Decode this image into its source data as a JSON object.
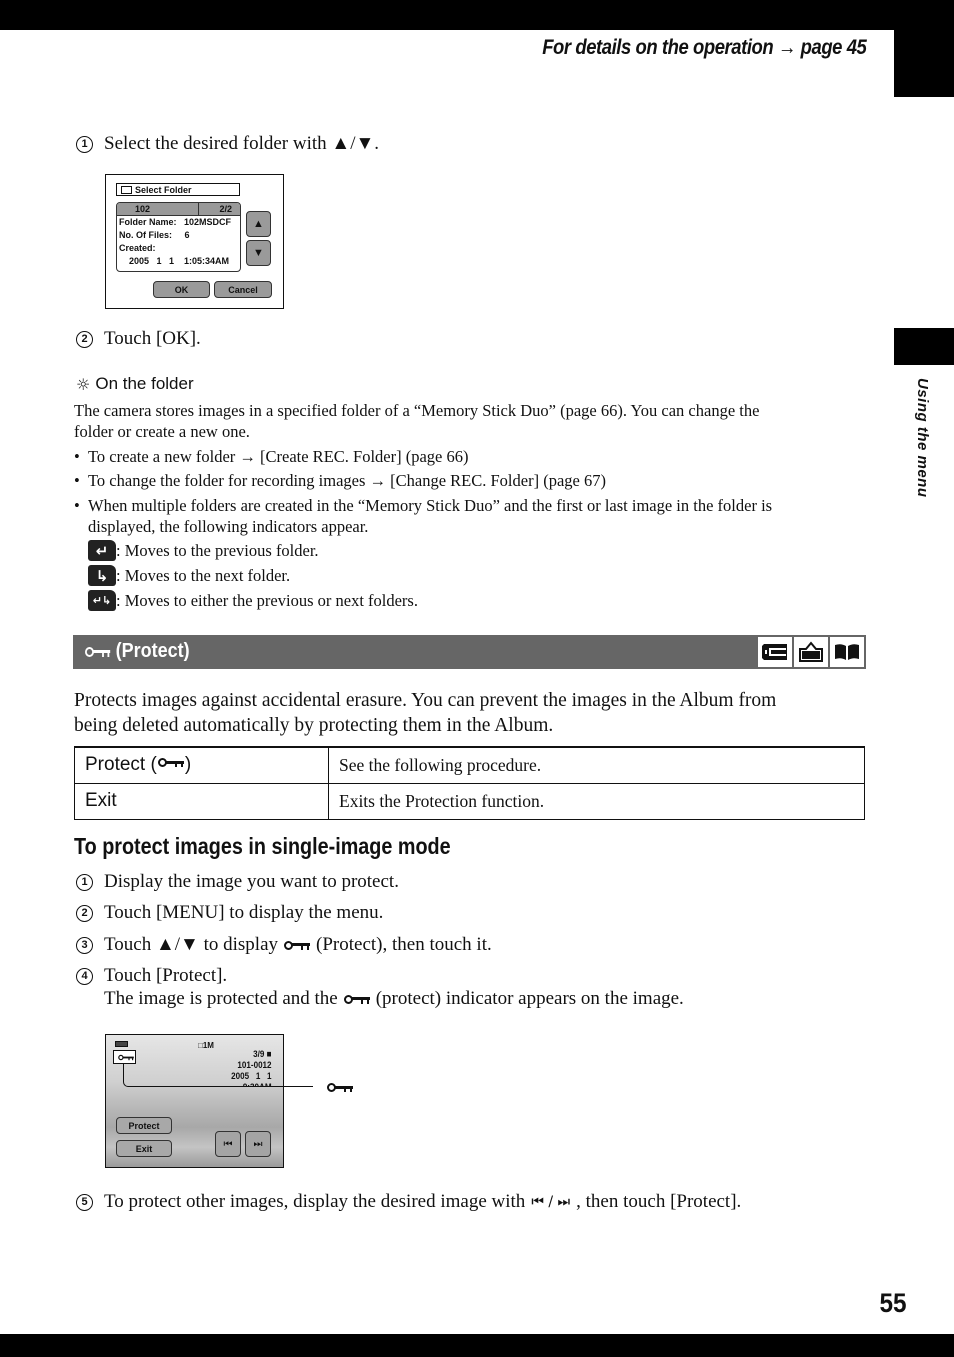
{
  "header": {
    "reference": "For details on the operation → page 45",
    "side_label": "Using the menu",
    "page_number": "55"
  },
  "select_folder_section": {
    "step1": {
      "num": "1",
      "text": "Select the desired folder with ▲/▼."
    },
    "camera_screen": {
      "title": "Select Folder",
      "folder_number": "102",
      "page_count": "2/2",
      "lines": [
        "Folder Name:   102MSDCF",
        "No. Of Files:     6",
        "Created:",
        "    2005   1   1    1:05:34AM"
      ],
      "up_button": "▲",
      "down_button": "▼",
      "ok_button": "OK",
      "cancel_button": "Cancel"
    },
    "step2": {
      "num": "2",
      "text": "Touch [OK]."
    }
  },
  "tip": {
    "icon": "lightbulb-icon",
    "heading": "On the folder",
    "paragraph_line1": "The camera stores images in a specified folder of a “Memory Stick Duo” (page 66). You can change the",
    "paragraph_line2": "folder or create a new one.",
    "bullets": [
      "To create a new folder → [Create REC. Folder] (page 66)",
      "To change the folder for recording images → [Change REC. Folder] (page 67)",
      "When multiple folders are created in the “Memory Stick Duo” and the first or last image in the folder is",
      "displayed, the following indicators appear."
    ],
    "indicators": [
      {
        "icon": "previous-folder-icon",
        "glyph": "↵",
        "text": ": Moves to the previous folder."
      },
      {
        "icon": "next-folder-icon",
        "glyph": "↳",
        "text": ": Moves to the next folder."
      },
      {
        "icon": "either-folder-icon",
        "glyph": "↵↳",
        "text": ": Moves to either the previous or next folders."
      }
    ]
  },
  "protect_section": {
    "title": "(Protect)",
    "mode_icons": [
      "memory-card-icon",
      "camera-icon",
      "album-icon"
    ],
    "description_line1": "Protects images against accidental erasure. You can prevent the images in the Album from",
    "description_line2": "being deleted automatically by protecting them in the Album.",
    "options": [
      {
        "key": "Protect (",
        "key_suffix": ")",
        "has_key_icon": true,
        "value": "See the following procedure."
      },
      {
        "key": "Exit",
        "key_suffix": "",
        "has_key_icon": false,
        "value": "Exits the Protection function."
      }
    ]
  },
  "single_image": {
    "heading": "To protect images in single-image mode",
    "steps": [
      {
        "num": "1",
        "text": "Display the image you want to protect."
      },
      {
        "num": "2",
        "text": "Touch [MENU] to display the menu."
      },
      {
        "num": "3",
        "text_before": "Touch ▲/▼ to display",
        "text_after": "(Protect), then touch it."
      },
      {
        "num": "4",
        "text": "Touch [Protect].",
        "sub_before": "The image is protected and the",
        "sub_after": "(protect) indicator appears on the image."
      },
      {
        "num": "5",
        "text_before": "To protect other images, display the desired image with",
        "nav_glyphs": "⏮ / ⏭",
        "text_after": ", then touch [Protect]."
      }
    ],
    "camera_screen": {
      "image_size": "1M",
      "counter": "3/9",
      "file_number": "101-0012",
      "date": "2005   1   1",
      "time": "9:30AM",
      "protect_button": "Protect",
      "exit_button": "Exit",
      "prev_button": "⏮",
      "next_button": "⏭"
    }
  }
}
